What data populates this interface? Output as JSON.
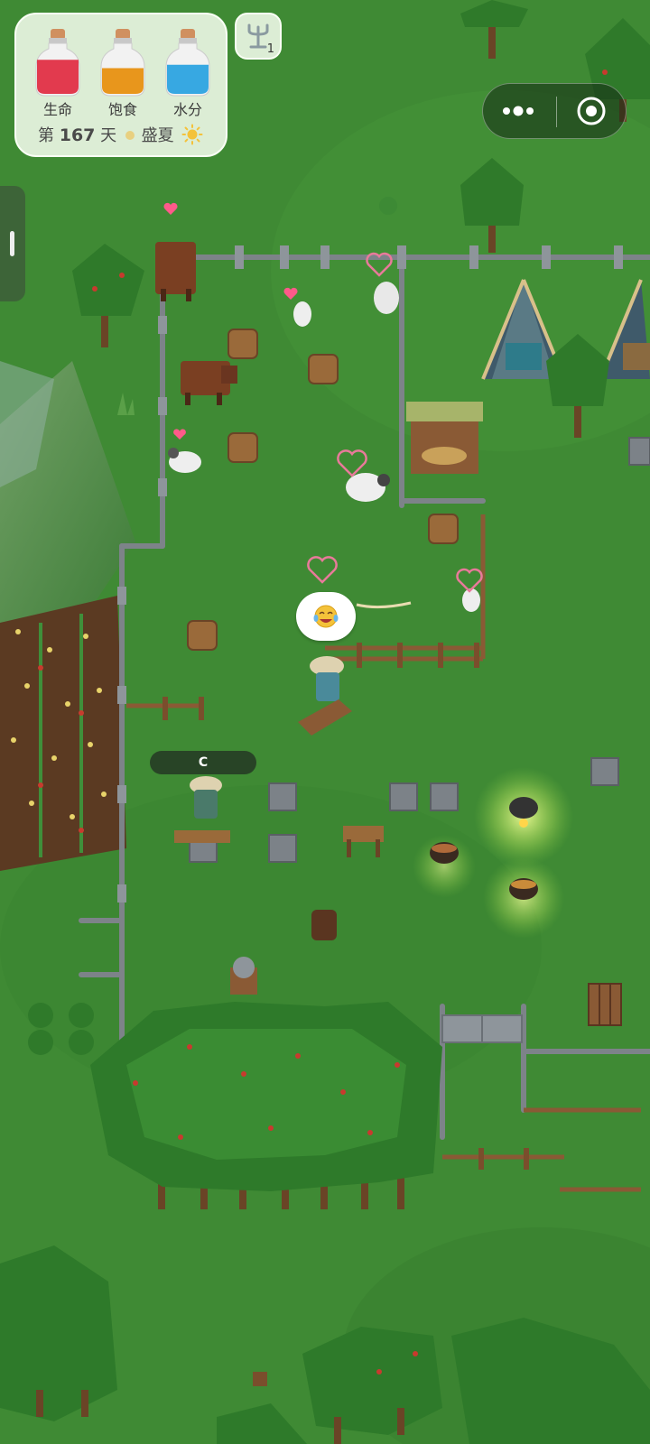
{
  "hud": {
    "bars": [
      {
        "label": "生命",
        "color": "#e23a4e",
        "level": 0.82
      },
      {
        "label": "饱食",
        "color": "#e8961c",
        "level": 0.62
      },
      {
        "label": "水分",
        "color": "#37a8e2",
        "level": 0.7
      }
    ],
    "day_prefix": "第",
    "day_number": "167",
    "day_suffix": "天",
    "season": "盛夏",
    "season_icon": "sun-icon"
  },
  "tools": {
    "icon": "antenna-icon",
    "count": "1"
  },
  "capsule": {
    "more_icon": "more-dots-icon",
    "close_icon": "target-circle-icon"
  },
  "player": {
    "name": "C",
    "emote_icon": "laughing-crying-face-icon"
  },
  "colors": {
    "grass": "#3f8a34",
    "fence": "#7d8389",
    "wood": "#8a5a35",
    "soil": "#5b3a22",
    "campfire_glow": "#f4ff8a"
  }
}
